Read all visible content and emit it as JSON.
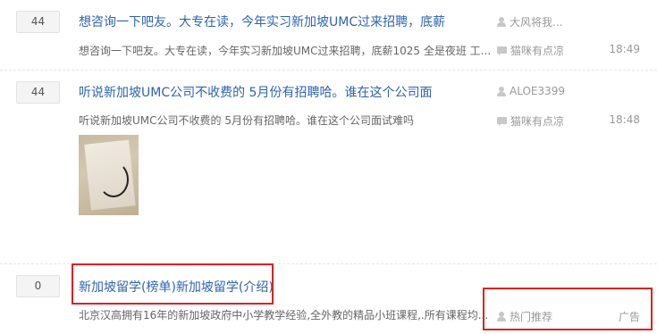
{
  "threads": [
    {
      "replies": "44",
      "title": "想咨询一下吧友。大专在读，今年实习新加坡UMC过来招聘，底薪",
      "abstract": "想咨询一下吧友。大专在读，今年实习新加坡UMC过来招聘，底薪1025 全是夜班 工...",
      "author": "大风将我...",
      "last_replier": "猫咪有点凉",
      "time": "18:49"
    },
    {
      "replies": "44",
      "title": "听说新加坡UMC公司不收费的 5月份有招聘哈。谁在这个公司面",
      "abstract": "听说新加坡UMC公司不收费的 5月份有招聘哈。谁在这个公司面试难吗",
      "author": "ALOE3399",
      "last_replier": "猫咪有点凉",
      "time": "18:48"
    },
    {
      "replies": "0",
      "title": "新加坡留学(榜单)新加坡留学(介绍)",
      "abstract": "北京汉高拥有16年的新加坡政府中小学教学经验,全外教的精品小班课程,.所有课程均...",
      "author": "热门推荐",
      "ad_label": "广告"
    }
  ],
  "icons": {
    "user": "user-icon",
    "reply": "reply-icon"
  },
  "colors": {
    "title_link": "#2d64b3",
    "highlight_box": "#e02020"
  }
}
